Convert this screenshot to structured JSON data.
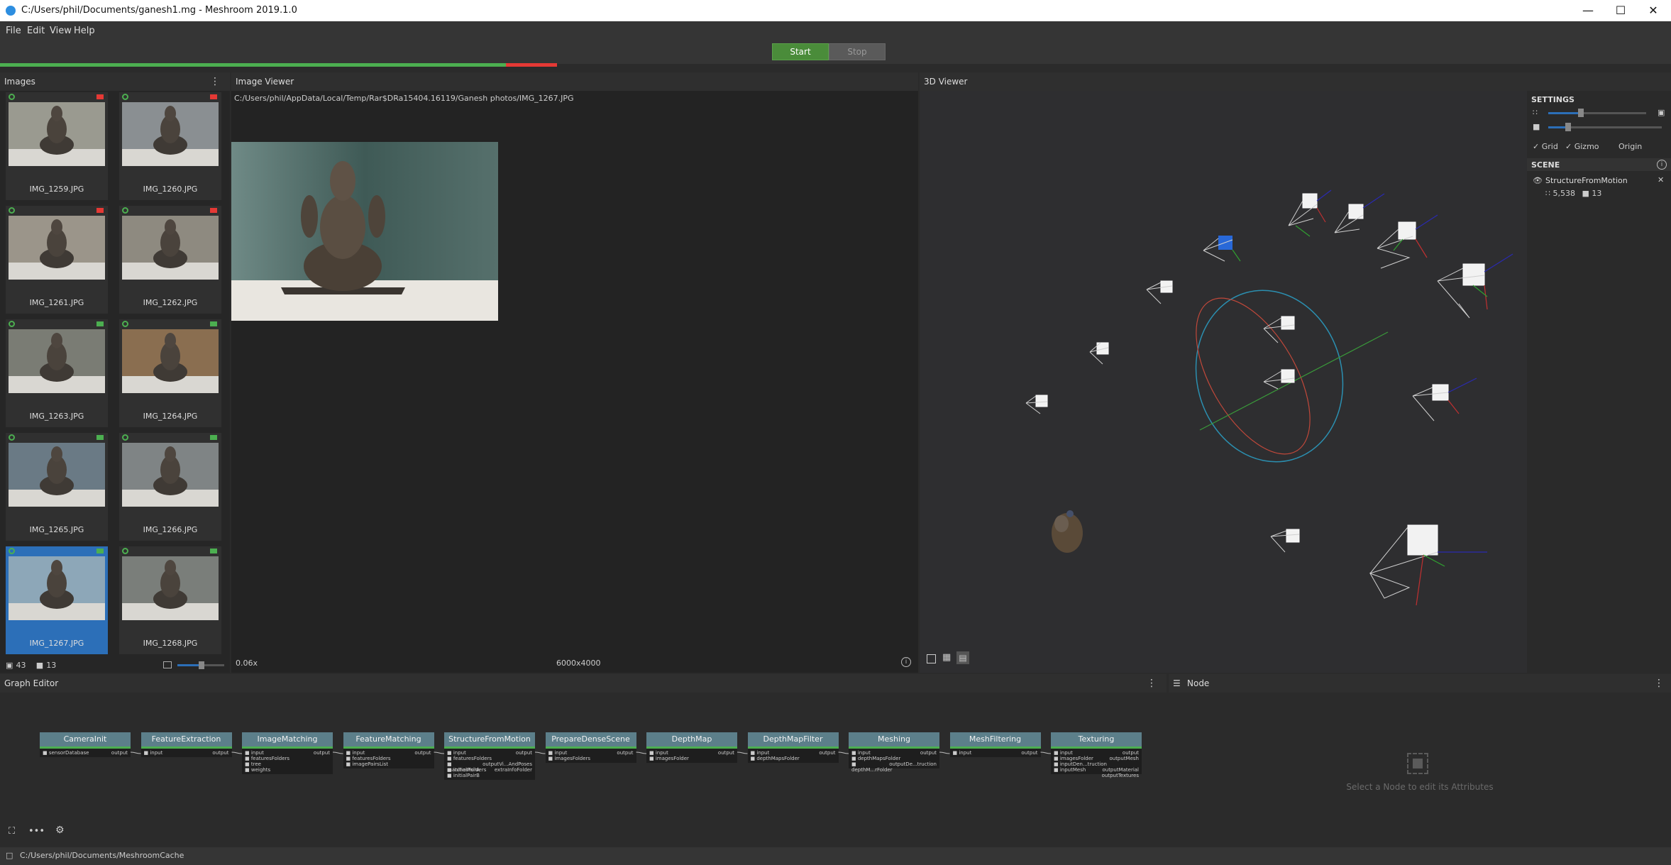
{
  "window": {
    "title": "C:/Users/phil/Documents/ganesh1.mg - Meshroom 2019.1.0"
  },
  "menu": [
    "File",
    "Edit",
    "View",
    "Help"
  ],
  "toolbar": {
    "start_label": "Start",
    "stop_label": "Stop"
  },
  "images_panel": {
    "title": "Images",
    "items": [
      {
        "label": "IMG_1259.JPG",
        "cam": "red"
      },
      {
        "label": "IMG_1260.JPG",
        "cam": "red"
      },
      {
        "label": "IMG_1261.JPG",
        "cam": "red"
      },
      {
        "label": "IMG_1262.JPG",
        "cam": "red"
      },
      {
        "label": "IMG_1263.JPG",
        "cam": "green"
      },
      {
        "label": "IMG_1264.JPG",
        "cam": "green"
      },
      {
        "label": "IMG_1265.JPG",
        "cam": "green"
      },
      {
        "label": "IMG_1266.JPG",
        "cam": "green"
      },
      {
        "label": "IMG_1267.JPG",
        "cam": "green"
      },
      {
        "label": "IMG_1268.JPG",
        "cam": "green"
      }
    ],
    "image_count": "43",
    "camera_count": "13"
  },
  "image_viewer": {
    "title": "Image Viewer",
    "path": "C:/Users/phil/AppData/Local/Temp/Rar$DRa15404.16119/Ganesh photos/IMG_1267.JPG",
    "zoom": "0.06x",
    "resolution": "6000x4000"
  },
  "viewer3d": {
    "title": "3D Viewer",
    "settings_title": "SETTINGS",
    "grid_label": "Grid",
    "gizmo_label": "Gizmo",
    "origin_label": "Origin",
    "scene_title": "SCENE",
    "scene_item": "StructureFromMotion",
    "points": "5,538",
    "cameras": "13"
  },
  "graph_editor": {
    "title": "Graph Editor",
    "nodes": [
      {
        "name": "CameraInit",
        "inputs": [
          "sensorDatabase"
        ],
        "outputs": [
          "output"
        ]
      },
      {
        "name": "FeatureExtraction",
        "inputs": [
          "input"
        ],
        "outputs": [
          "output"
        ]
      },
      {
        "name": "ImageMatching",
        "inputs": [
          "input",
          "featuresFolders",
          "tree",
          "weights"
        ],
        "outputs": [
          "output"
        ]
      },
      {
        "name": "FeatureMatching",
        "inputs": [
          "input",
          "featuresFolders",
          "imagePairsList"
        ],
        "outputs": [
          "output"
        ]
      },
      {
        "name": "StructureFromMotion",
        "inputs": [
          "input",
          "featuresFolders",
          "matchesFolders",
          "initialPairA",
          "initialPairB"
        ],
        "outputs": [
          "output",
          "outputVi...AndPoses",
          "extraInfoFolder"
        ]
      },
      {
        "name": "PrepareDenseScene",
        "inputs": [
          "input",
          "imagesFolders"
        ],
        "outputs": [
          "output"
        ]
      },
      {
        "name": "DepthMap",
        "inputs": [
          "input",
          "imagesFolder"
        ],
        "outputs": [
          "output"
        ]
      },
      {
        "name": "DepthMapFilter",
        "inputs": [
          "input",
          "depthMapsFolder"
        ],
        "outputs": [
          "output"
        ]
      },
      {
        "name": "Meshing",
        "inputs": [
          "input",
          "depthMapsFolder",
          "depthM...rFolder"
        ],
        "outputs": [
          "output",
          "outputDe...truction"
        ]
      },
      {
        "name": "MeshFiltering",
        "inputs": [
          "input"
        ],
        "outputs": [
          "output"
        ]
      },
      {
        "name": "Texturing",
        "inputs": [
          "input",
          "imagesFolder",
          "inputDen...truction",
          "inputMesh"
        ],
        "outputs": [
          "output",
          "outputMesh",
          "outputMaterial",
          "outputTextures"
        ]
      }
    ]
  },
  "node_panel": {
    "title": "Node",
    "placeholder": "Select a Node to edit its Attributes"
  },
  "statusbar": {
    "path": "C:/Users/phil/Documents/MeshroomCache"
  },
  "colors": {
    "accent": "#2c6fb8",
    "ok": "#4caf50",
    "error": "#e53935",
    "node_header": "#5c7f8a"
  }
}
